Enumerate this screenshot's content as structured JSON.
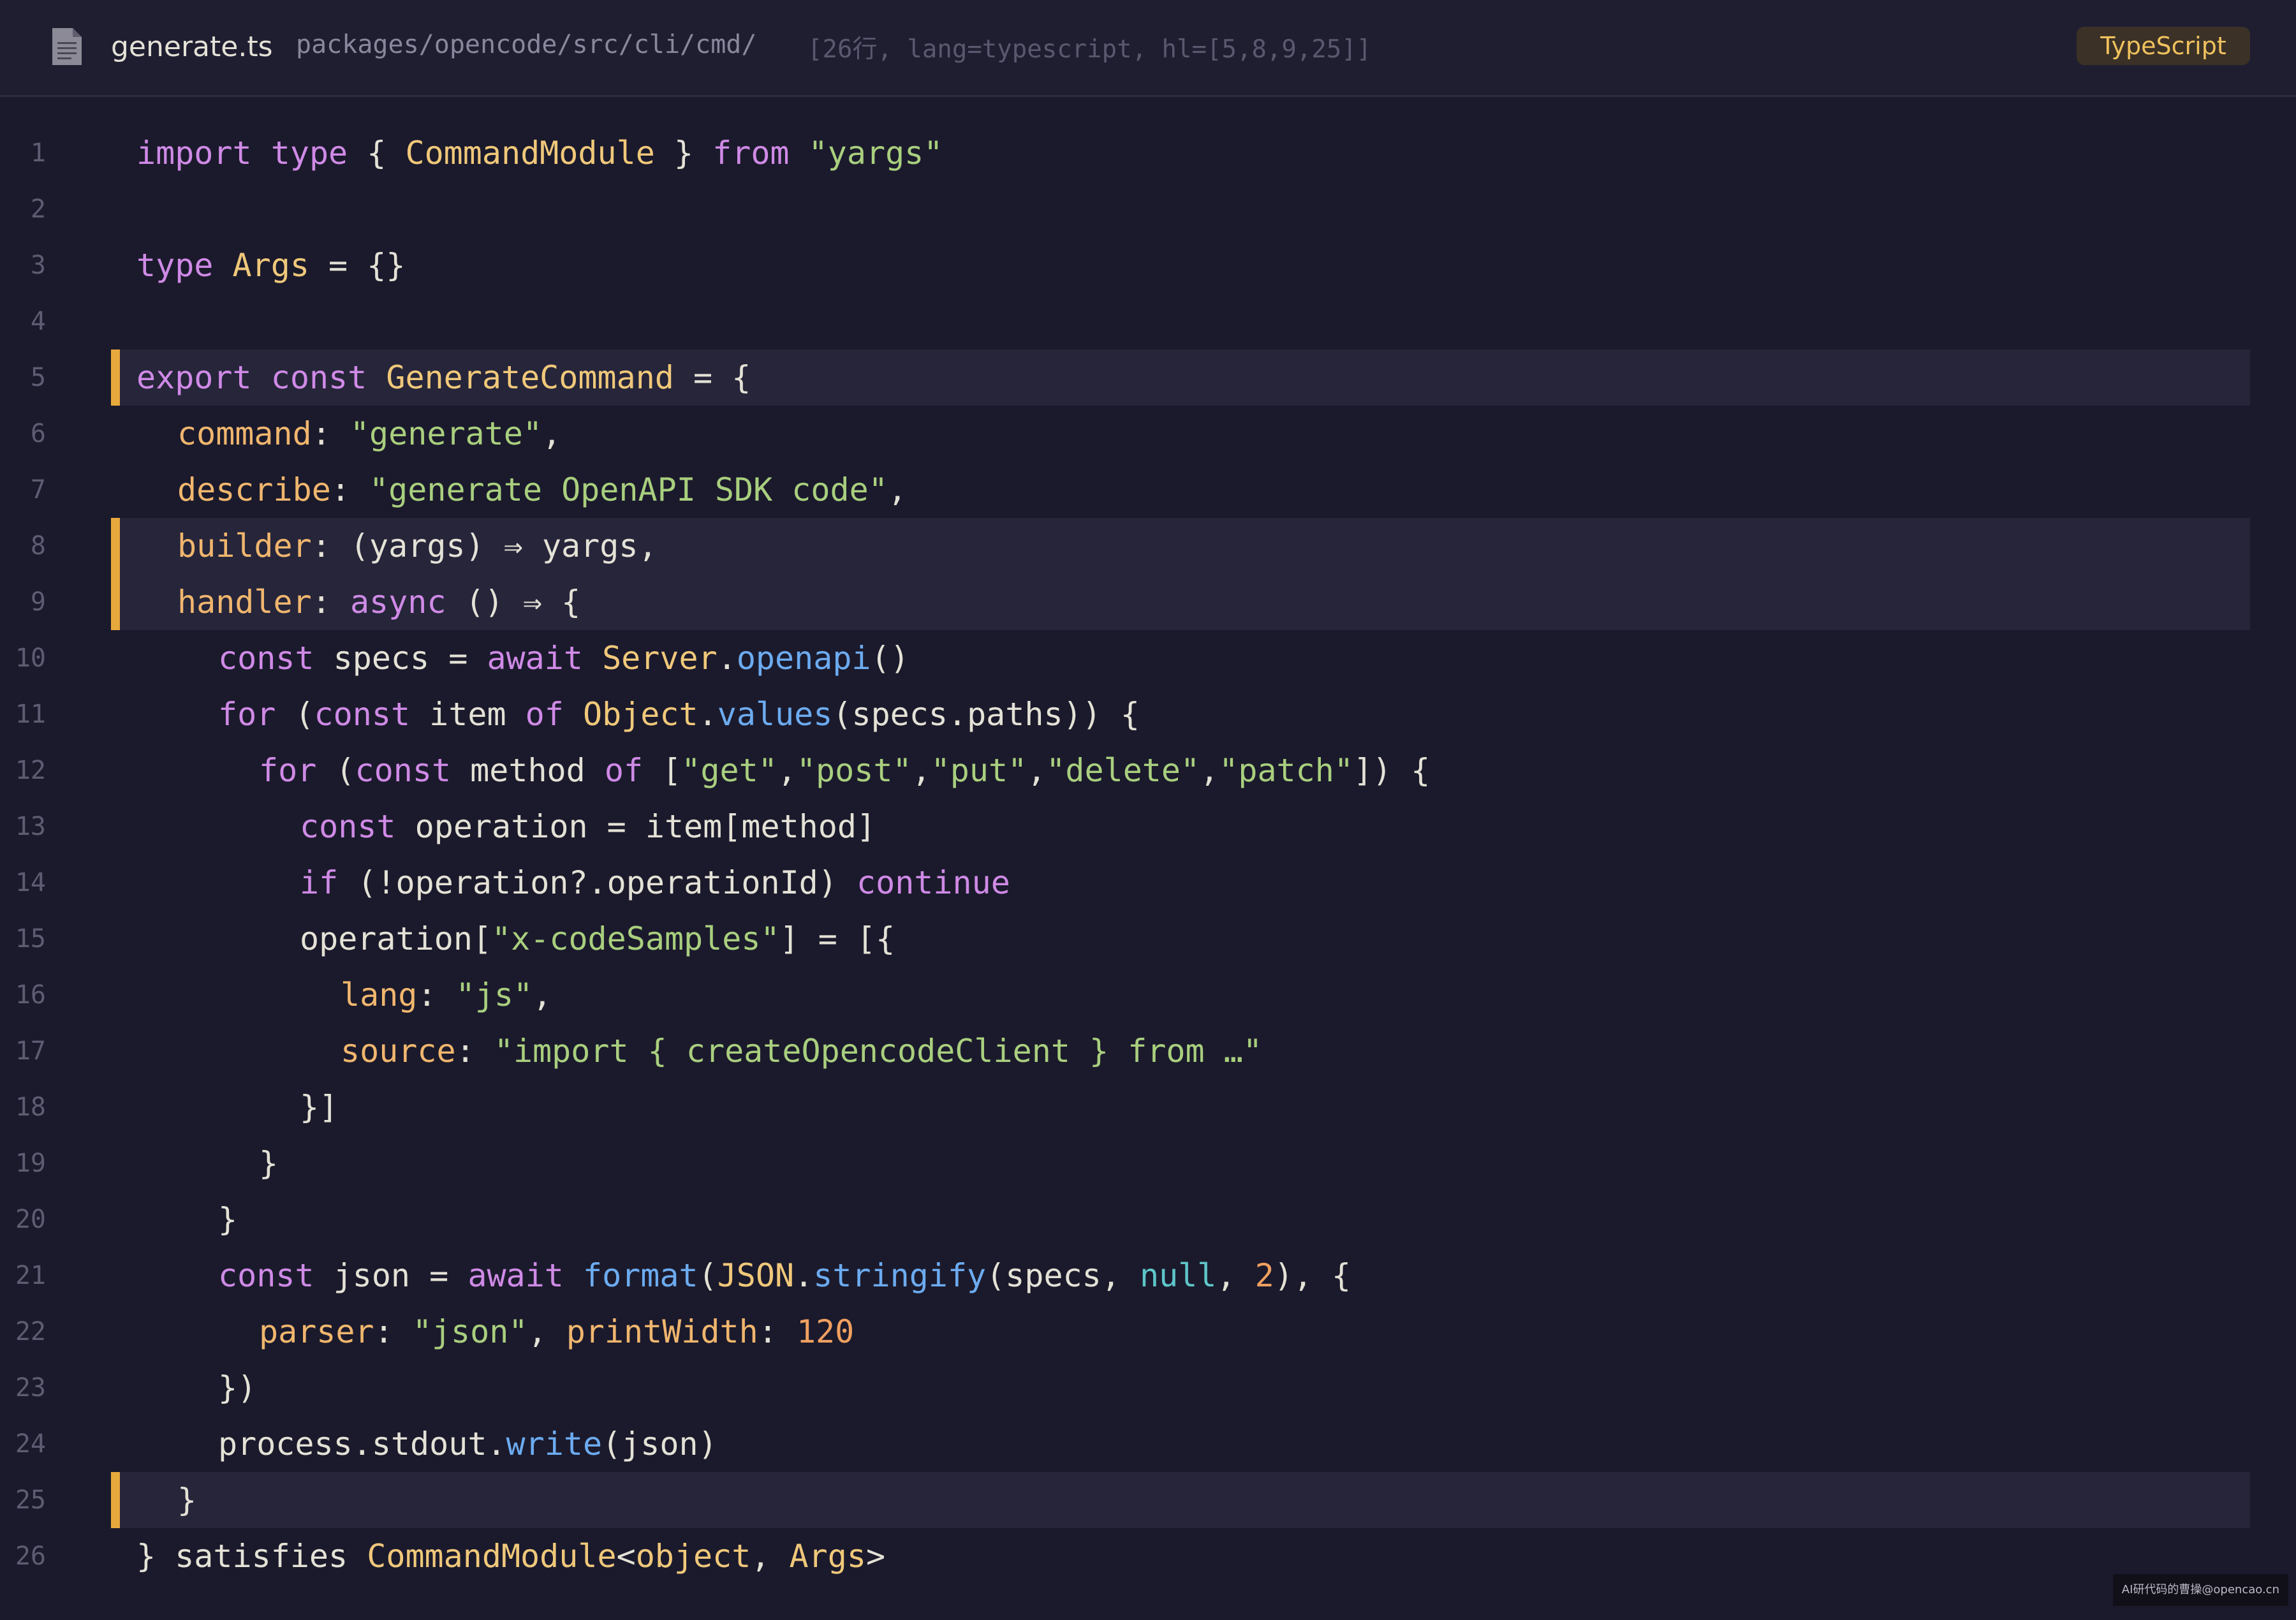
{
  "header": {
    "file_icon": "document-icon",
    "file_name": "generate.ts",
    "file_path": "packages/opencode/src/cli/cmd/",
    "file_meta": "[26行, lang=typescript, hl=[5,8,9,25]]",
    "language_badge": "TypeScript"
  },
  "colors": {
    "background": "#1b1a2c",
    "header_background": "#1f1e31",
    "highlight_background": "#26253a",
    "highlight_bar": "#e8a93c",
    "keyword": "#cf8ae6",
    "type": "#f0c87a",
    "string": "#a9cf7e",
    "property": "#f0b66e",
    "function": "#6cabf0",
    "number": "#f0a060",
    "null": "#5ec6c9",
    "plain": "#e4e1d6",
    "line_number": "#5e5c72"
  },
  "code": {
    "highlighted_lines": [
      5,
      8,
      9,
      25
    ],
    "lines": [
      {
        "n": "1",
        "indent": 0,
        "tokens": [
          {
            "t": "import",
            "c": "kw"
          },
          {
            "t": " "
          },
          {
            "t": "type",
            "c": "kw"
          },
          {
            "t": " { "
          },
          {
            "t": "CommandModule",
            "c": "ty"
          },
          {
            "t": " } "
          },
          {
            "t": "from",
            "c": "kw"
          },
          {
            "t": " "
          },
          {
            "t": "\"yargs\"",
            "c": "st"
          }
        ]
      },
      {
        "n": "2",
        "indent": 0,
        "tokens": []
      },
      {
        "n": "3",
        "indent": 0,
        "tokens": [
          {
            "t": "type",
            "c": "kw"
          },
          {
            "t": " "
          },
          {
            "t": "Args",
            "c": "ty"
          },
          {
            "t": " = {}"
          }
        ]
      },
      {
        "n": "4",
        "indent": 0,
        "tokens": []
      },
      {
        "n": "5",
        "indent": 0,
        "tokens": [
          {
            "t": "export",
            "c": "kw"
          },
          {
            "t": " "
          },
          {
            "t": "const",
            "c": "kw"
          },
          {
            "t": " "
          },
          {
            "t": "GenerateCommand",
            "c": "ty"
          },
          {
            "t": " = {"
          }
        ]
      },
      {
        "n": "6",
        "indent": 1,
        "tokens": [
          {
            "t": "command",
            "c": "pr"
          },
          {
            "t": ": "
          },
          {
            "t": "\"generate\"",
            "c": "st"
          },
          {
            "t": ","
          }
        ]
      },
      {
        "n": "7",
        "indent": 1,
        "tokens": [
          {
            "t": "describe",
            "c": "pr"
          },
          {
            "t": ": "
          },
          {
            "t": "\"generate OpenAPI SDK code\"",
            "c": "st"
          },
          {
            "t": ","
          }
        ]
      },
      {
        "n": "8",
        "indent": 1,
        "tokens": [
          {
            "t": "builder",
            "c": "pr"
          },
          {
            "t": ": (yargs) ⇒ yargs,"
          }
        ]
      },
      {
        "n": "9",
        "indent": 1,
        "tokens": [
          {
            "t": "handler",
            "c": "pr"
          },
          {
            "t": ": "
          },
          {
            "t": "async",
            "c": "kw"
          },
          {
            "t": " () ⇒ {"
          }
        ]
      },
      {
        "n": "10",
        "indent": 2,
        "tokens": [
          {
            "t": "const",
            "c": "kw"
          },
          {
            "t": " specs = "
          },
          {
            "t": "await",
            "c": "kw"
          },
          {
            "t": " "
          },
          {
            "t": "Server",
            "c": "ty"
          },
          {
            "t": "."
          },
          {
            "t": "openapi",
            "c": "fn"
          },
          {
            "t": "()"
          }
        ]
      },
      {
        "n": "11",
        "indent": 2,
        "tokens": [
          {
            "t": "for",
            "c": "kw"
          },
          {
            "t": " ("
          },
          {
            "t": "const",
            "c": "kw"
          },
          {
            "t": " item "
          },
          {
            "t": "of",
            "c": "kw"
          },
          {
            "t": " "
          },
          {
            "t": "Object",
            "c": "ty"
          },
          {
            "t": "."
          },
          {
            "t": "values",
            "c": "fn"
          },
          {
            "t": "(specs.paths)) {"
          }
        ]
      },
      {
        "n": "12",
        "indent": 3,
        "tokens": [
          {
            "t": "for",
            "c": "kw"
          },
          {
            "t": " ("
          },
          {
            "t": "const",
            "c": "kw"
          },
          {
            "t": " method "
          },
          {
            "t": "of",
            "c": "kw"
          },
          {
            "t": " ["
          },
          {
            "t": "\"get\"",
            "c": "st"
          },
          {
            "t": ","
          },
          {
            "t": "\"post\"",
            "c": "st"
          },
          {
            "t": ","
          },
          {
            "t": "\"put\"",
            "c": "st"
          },
          {
            "t": ","
          },
          {
            "t": "\"delete\"",
            "c": "st"
          },
          {
            "t": ","
          },
          {
            "t": "\"patch\"",
            "c": "st"
          },
          {
            "t": "]) {"
          }
        ]
      },
      {
        "n": "13",
        "indent": 4,
        "tokens": [
          {
            "t": "const",
            "c": "kw"
          },
          {
            "t": " operation = item[method]"
          }
        ]
      },
      {
        "n": "14",
        "indent": 4,
        "tokens": [
          {
            "t": "if",
            "c": "kw"
          },
          {
            "t": " (!operation?.operationId) "
          },
          {
            "t": "continue",
            "c": "kw"
          }
        ]
      },
      {
        "n": "15",
        "indent": 4,
        "tokens": [
          {
            "t": "operation["
          },
          {
            "t": "\"x-codeSamples\"",
            "c": "st"
          },
          {
            "t": "] = [{"
          }
        ]
      },
      {
        "n": "16",
        "indent": 5,
        "tokens": [
          {
            "t": "lang",
            "c": "pr"
          },
          {
            "t": ": "
          },
          {
            "t": "\"js\"",
            "c": "st"
          },
          {
            "t": ","
          }
        ]
      },
      {
        "n": "17",
        "indent": 5,
        "tokens": [
          {
            "t": "source",
            "c": "pr"
          },
          {
            "t": ": "
          },
          {
            "t": "\"import { createOpencodeClient } from …\"",
            "c": "st"
          }
        ]
      },
      {
        "n": "18",
        "indent": 4,
        "tokens": [
          {
            "t": "}]"
          }
        ]
      },
      {
        "n": "19",
        "indent": 3,
        "tokens": [
          {
            "t": "}"
          }
        ]
      },
      {
        "n": "20",
        "indent": 2,
        "tokens": [
          {
            "t": "}"
          }
        ]
      },
      {
        "n": "21",
        "indent": 2,
        "tokens": [
          {
            "t": "const",
            "c": "kw"
          },
          {
            "t": " json = "
          },
          {
            "t": "await",
            "c": "kw"
          },
          {
            "t": " "
          },
          {
            "t": "format",
            "c": "fn"
          },
          {
            "t": "("
          },
          {
            "t": "JSON",
            "c": "ty"
          },
          {
            "t": "."
          },
          {
            "t": "stringify",
            "c": "fn"
          },
          {
            "t": "(specs, "
          },
          {
            "t": "null",
            "c": "nl"
          },
          {
            "t": ", "
          },
          {
            "t": "2",
            "c": "nu"
          },
          {
            "t": "), {"
          }
        ]
      },
      {
        "n": "22",
        "indent": 3,
        "tokens": [
          {
            "t": "parser",
            "c": "pr"
          },
          {
            "t": ": "
          },
          {
            "t": "\"json\"",
            "c": "st"
          },
          {
            "t": ", "
          },
          {
            "t": "printWidth",
            "c": "pr"
          },
          {
            "t": ": "
          },
          {
            "t": "120",
            "c": "nu"
          }
        ]
      },
      {
        "n": "23",
        "indent": 2,
        "tokens": [
          {
            "t": "})"
          }
        ]
      },
      {
        "n": "24",
        "indent": 2,
        "tokens": [
          {
            "t": "process.stdout."
          },
          {
            "t": "write",
            "c": "fn"
          },
          {
            "t": "(json)"
          }
        ]
      },
      {
        "n": "25",
        "indent": 1,
        "tokens": [
          {
            "t": "}"
          }
        ]
      },
      {
        "n": "26",
        "indent": 0,
        "tokens": [
          {
            "t": "} satisfies "
          },
          {
            "t": "CommandModule",
            "c": "ty"
          },
          {
            "t": "<"
          },
          {
            "t": "object",
            "c": "ty"
          },
          {
            "t": ", "
          },
          {
            "t": "Args",
            "c": "ty"
          },
          {
            "t": ">"
          }
        ]
      }
    ]
  },
  "watermark": "AI研代码的曹操@opencao.cn"
}
